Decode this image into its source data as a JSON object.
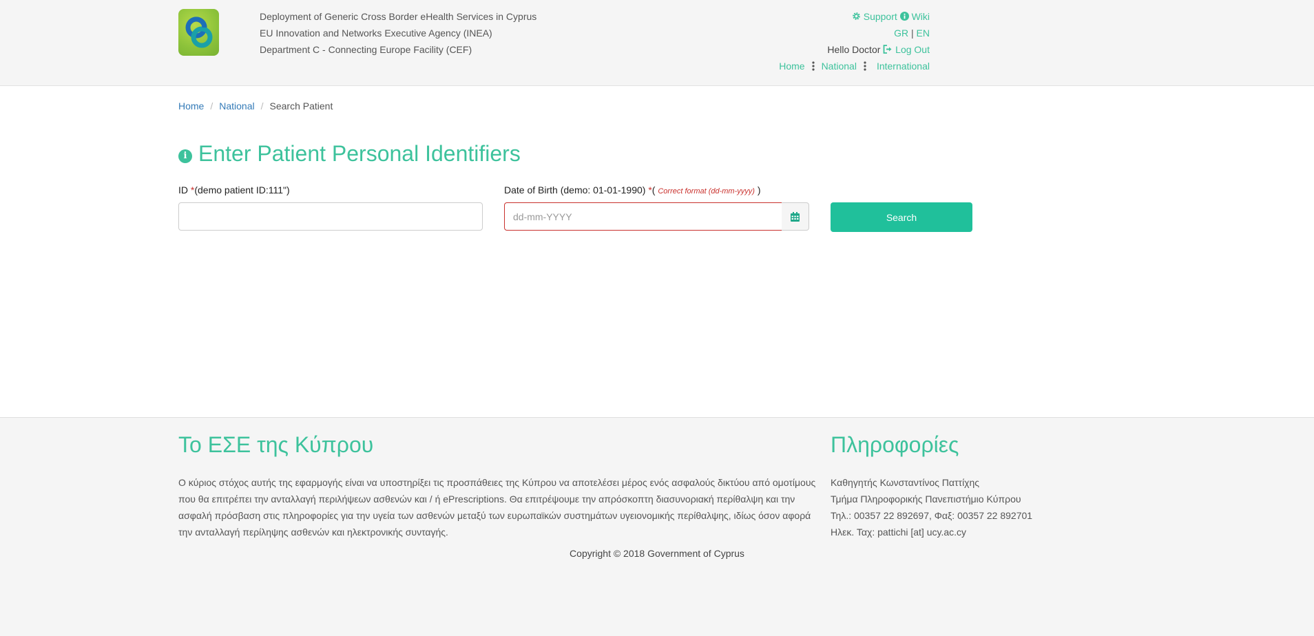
{
  "header": {
    "lines": [
      "Deployment of Generic Cross Border eHealth Services in Cyprus",
      "EU Innovation and Networks Executive Agency (INEA)",
      "Department C - Connecting Europe Facility (CEF)"
    ],
    "support_label": "Support",
    "wiki_label": "Wiki",
    "lang_gr": "GR",
    "lang_sep": "|",
    "lang_en": "EN",
    "greeting": "Hello Doctor",
    "logout_label": "Log Out",
    "nav": [
      "Home",
      "National",
      "International"
    ]
  },
  "breadcrumb": {
    "home": "Home",
    "national": "National",
    "current": "Search Patient"
  },
  "page_title": "Enter Patient Personal Identifiers",
  "form": {
    "id_label": "ID",
    "required_mark": "*",
    "id_hint": "(demo patient ID:111\")",
    "id_value": "",
    "dob_label": "Date of Birth (demo: 01-01-1990)",
    "dob_open": "(",
    "dob_format": "Correct format (dd-mm-yyyy)",
    "dob_close": ")",
    "dob_placeholder": "dd-mm-YYYY",
    "search_label": "Search"
  },
  "footer": {
    "left_title": "Το ΕΣΕ της Κύπρου",
    "left_text": "Ο κύριος στόχος αυτής της εφαρμογής είναι να υποστηρίξει τις προσπάθειες της Κύπρου να αποτελέσει μέρος ενός ασφαλούς δικτύου από ομοτίμους που θα επιτρέπει την ανταλλαγή περιλήψεων ασθενών και / ή ePrescriptions. Θα επιτρέψουμε την απρόσκοπτη διασυνοριακή περίθαλψη και την ασφαλή πρόσβαση στις πληροφορίες για την υγεία των ασθενών μεταξύ των ευρωπαϊκών συστημάτων υγειονομικής περίθαλψης, ιδίως όσον αφορά την ανταλλαγή περίληψης ασθενών και ηλεκτρονικής συνταγής.",
    "right_title": "Πληροφορίες",
    "info_lines": [
      "Καθηγητής Κωνσταντίνος Παττίχης",
      "Τμήμα Πληροφορικής Πανεπιστήμιο Κύπρου",
      "Τηλ.: 00357 22 892697, Φαξ: 00357 22 892701",
      "Ηλεκ. Ταχ: pattichi [at] ucy.ac.cy"
    ],
    "copyright": "Copyright © 2018 Government of Cyprus"
  },
  "colors": {
    "accent": "#3dc29c",
    "button": "#20c09b",
    "error": "#c9302c",
    "link": "#337ab7"
  }
}
